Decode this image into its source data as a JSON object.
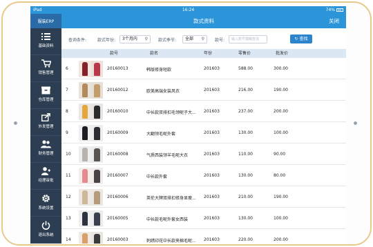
{
  "status_bar": {
    "carrier": "iPad",
    "time": "16:24",
    "battery": "74%"
  },
  "sidebar": {
    "header": "服装ERP",
    "items": [
      {
        "label": "基础资料",
        "icon": "list-icon"
      },
      {
        "label": "销售管理",
        "icon": "cart-icon"
      },
      {
        "label": "仓库管理",
        "icon": "box-icon"
      },
      {
        "label": "外发管理",
        "icon": "share-icon"
      },
      {
        "label": "财务管理",
        "icon": "users-icon"
      },
      {
        "label": "经理审批",
        "icon": "person-icon"
      },
      {
        "label": "系统设置",
        "icon": "gear-icon"
      },
      {
        "label": "退出系统",
        "icon": "power-icon"
      }
    ]
  },
  "topbar": {
    "title": "款式资料",
    "close_label": "关闭"
  },
  "filter": {
    "query_label": "查询条件:",
    "year_label": "款式年份:",
    "year_value": "3个月内",
    "season_label": "款式季节:",
    "season_value": "全部",
    "code_label": "款号:",
    "code_placeholder": "输入款号模糊查找",
    "search_label": "查找"
  },
  "table": {
    "columns": [
      "款号",
      "款名",
      "年份",
      "零售价",
      "批发价"
    ],
    "rows": [
      {
        "idx": "6",
        "code": "20160013",
        "name": "韩版修身短款",
        "year": "201603",
        "retail": "588.00",
        "wholesale": "300.00",
        "colors": [
          "#f2e6df",
          "#8a1f2c",
          "#ece2dc",
          "#b9384a"
        ]
      },
      {
        "idx": "7",
        "code": "20160012",
        "name": "欧美高端女装风衣",
        "year": "201603",
        "retail": "216.00",
        "wholesale": "190.00",
        "colors": [
          "#e9e3da",
          "#b48a5a",
          "#e6dfd6",
          "#c49b6b"
        ]
      },
      {
        "idx": "8",
        "code": "20160010",
        "name": "中长款双排扣毛领呢子大...",
        "year": "201603",
        "retail": "237.00",
        "wholesale": "200.00",
        "colors": [
          "#eae7e4",
          "#e4a73a",
          "#e7e4e1",
          "#2a2a2a"
        ]
      },
      {
        "idx": "9",
        "code": "20160009",
        "name": "大翻领毛呢外套",
        "year": "201603",
        "retail": "130.00",
        "wholesale": "100.00",
        "colors": [
          "#efefef",
          "#1d1d22",
          "#ededed",
          "#2d2d33"
        ]
      },
      {
        "idx": "10",
        "code": "20160008",
        "name": "气质西装领羊毛呢大衣",
        "year": "201603",
        "retail": "110.00",
        "wholesale": "90.00",
        "colors": [
          "#eeeeee",
          "#b9b2ad",
          "#ebebeb",
          "#5a5552"
        ]
      },
      {
        "idx": "11",
        "code": "20160007",
        "name": "中长款外套",
        "year": "201603",
        "retail": "130.00",
        "wholesale": "80.00",
        "colors": [
          "#f1eeec",
          "#e68a8f",
          "#efeceb",
          "#4a4346"
        ]
      },
      {
        "idx": "12",
        "code": "20160006",
        "name": "英伦大牌双排扣修身显瘦...",
        "year": "201603",
        "retail": "210.00",
        "wholesale": "190.00",
        "colors": [
          "#ece8e3",
          "#cfb79a",
          "#eae6e1",
          "#b59a7c"
        ]
      },
      {
        "idx": "13",
        "code": "20160005",
        "name": "中长款毛呢外套女西装",
        "year": "201603",
        "retail": "130.00",
        "wholesale": "100.00",
        "colors": [
          "#eeeeee",
          "#2c3240",
          "#ebebeb",
          "#3a4050"
        ]
      },
      {
        "idx": "14",
        "code": "20160003",
        "name": "刺绣印花中长款夹棉毛呢...",
        "year": "201603",
        "retail": "220.00",
        "wholesale": "200.00",
        "colors": [
          "#eeeae6",
          "#d9a067",
          "#e9e5e1",
          "#3b3a3c"
        ]
      }
    ]
  }
}
